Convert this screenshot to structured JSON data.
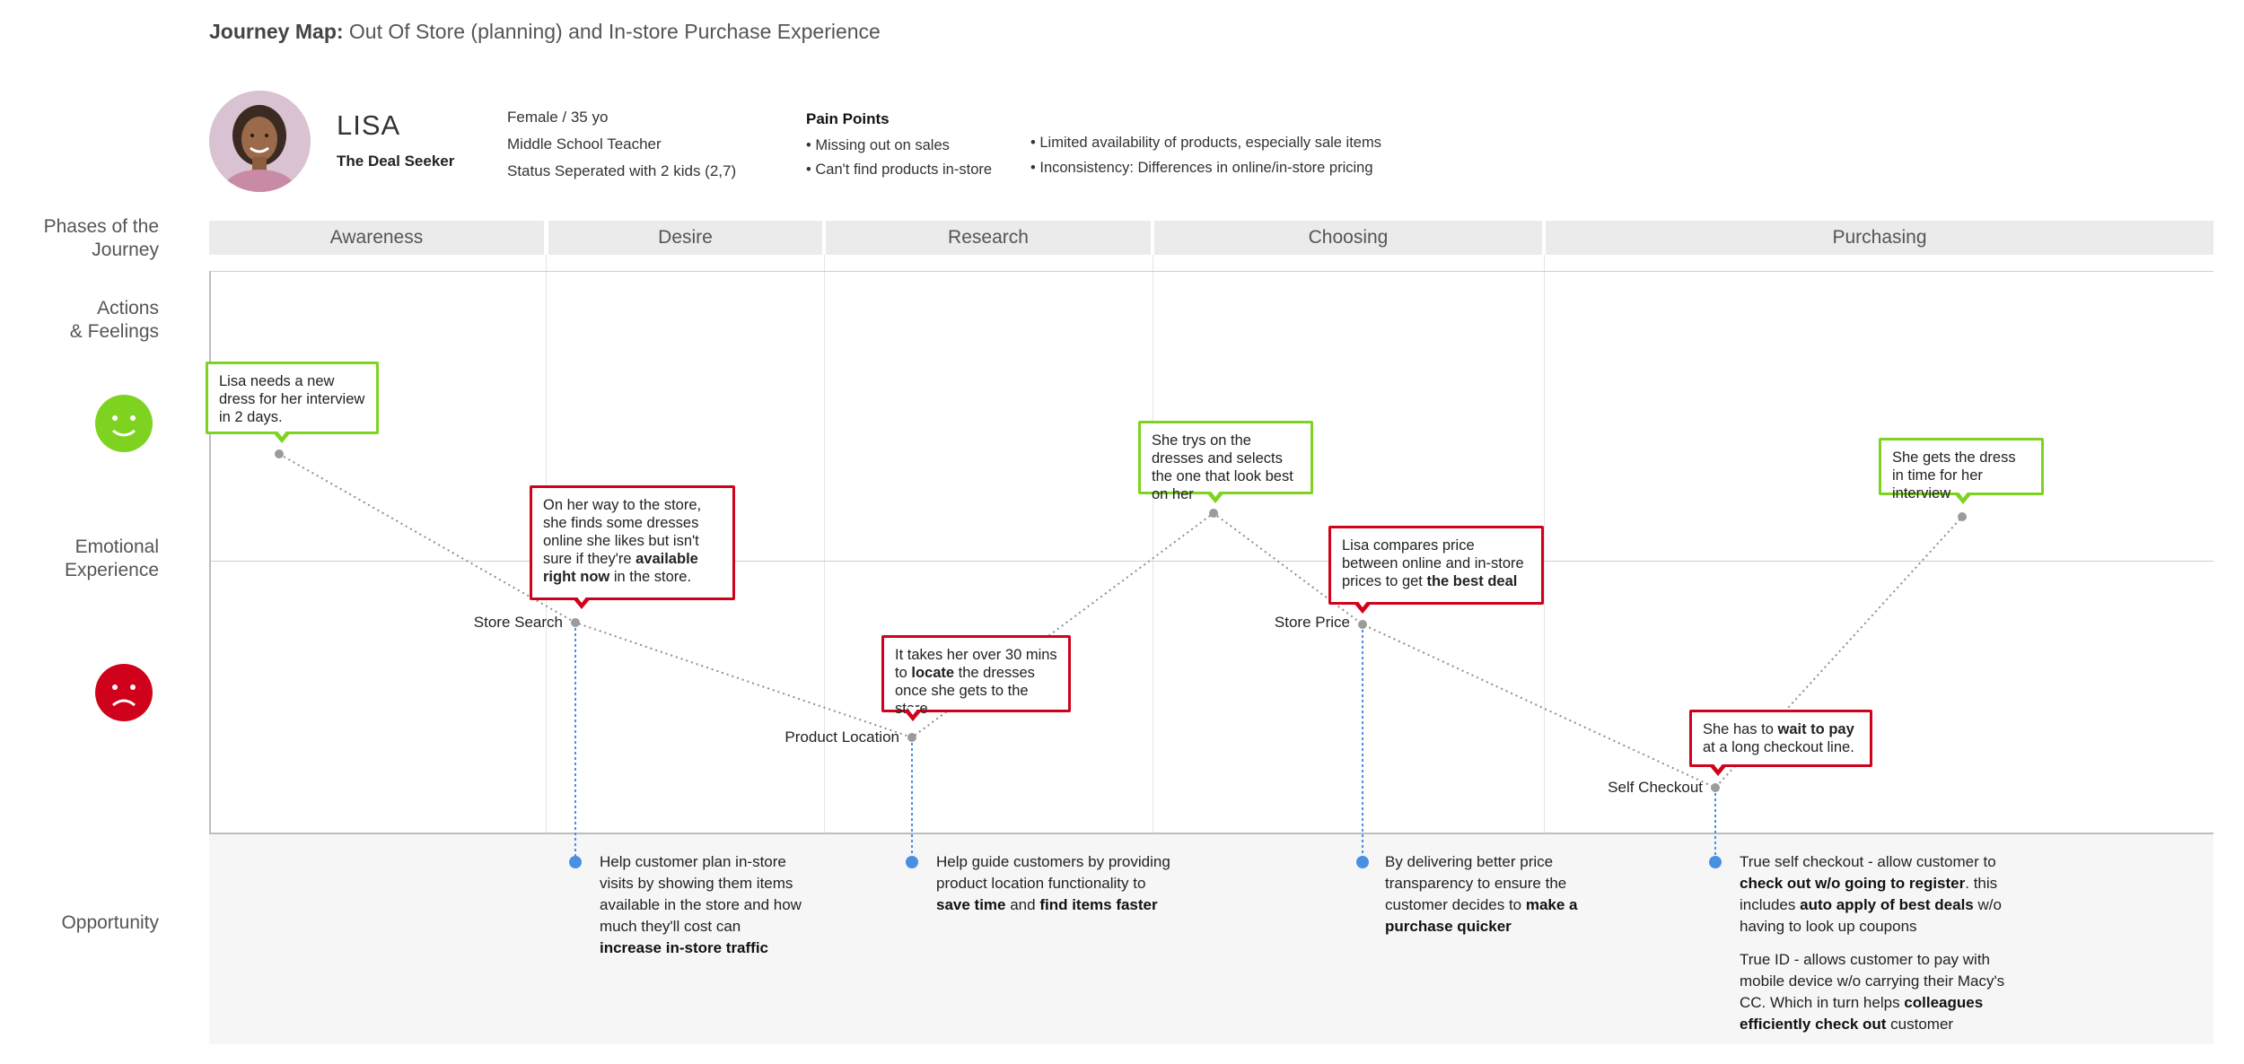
{
  "header": {
    "title_bold": "Journey Map:",
    "title_rest": " Out Of Store (planning) and In-store Purchase Experience"
  },
  "persona": {
    "name": "LISA",
    "subtitle": "The Deal Seeker",
    "details": [
      "Female / 35 yo",
      "Middle School Teacher",
      "Status Seperated with 2 kids (2,7)"
    ],
    "pain_points_title": "Pain Points",
    "pain_points_col1": [
      "Missing out on sales",
      "Can't find products in-store"
    ],
    "pain_points_col2": [
      "Limited availability of products, especially sale items",
      "Inconsistency:  Differences in online/in-store pricing"
    ]
  },
  "row_labels": {
    "phases": [
      "Phases of the",
      "Journey"
    ],
    "actions": [
      "Actions",
      "& Feelings"
    ],
    "emotional": [
      "Emotional",
      "Experience"
    ],
    "opportunity": "Opportunity"
  },
  "phases": [
    "Awareness",
    "Desire",
    "Research",
    "Choosing",
    "Purchasing"
  ],
  "colors": {
    "positive": "#7ed321",
    "negative": "#d0021b",
    "opportunity_dot": "#4a90e2",
    "journey_point": "#9b9b9b"
  },
  "icons": {
    "happy": "smiling-face-icon",
    "sad": "frowning-face-icon"
  },
  "journey": {
    "points": [
      {
        "id": "p1",
        "emotion": "positive",
        "label": ""
      },
      {
        "id": "p2",
        "emotion": "negative",
        "label": "Store Search"
      },
      {
        "id": "p3",
        "emotion": "negative",
        "label": "Product Location"
      },
      {
        "id": "p4",
        "emotion": "positive",
        "label": ""
      },
      {
        "id": "p5",
        "emotion": "negative",
        "label": "Store Price"
      },
      {
        "id": "p6",
        "emotion": "negative",
        "label": "Self Checkout"
      },
      {
        "id": "p7",
        "emotion": "positive",
        "label": ""
      }
    ],
    "callouts": {
      "c1": "Lisa needs a new dress for her interview in 2 days.",
      "c2_a": "On her way to the store, she finds some dresses online she likes but isn't sure if they're ",
      "c2_b": "available right now",
      "c2_c": " in the store.",
      "c3_a": "It takes her over 30 mins to ",
      "c3_b": "locate",
      "c3_c": " the dresses once she gets to the store",
      "c4": "She trys on the dresses and selects the one that look best on her",
      "c5_a": "Lisa compares price between online and in-store prices to get ",
      "c5_b": "the best deal",
      "c6_a": "She has to ",
      "c6_b": "wait to pay",
      "c6_c": " at a long checkout line.",
      "c7": "She gets the dress in time for her interview"
    }
  },
  "opportunities": {
    "o1_a": "Help customer plan in-store visits by showing them items available in the store and how much they'll cost can ",
    "o1_b": "increase in-store traffic",
    "o2_a": "Help guide customers by providing product location functionality to ",
    "o2_b": "save time",
    "o2_c": " and ",
    "o2_d": "find items faster",
    "o3_a": "By delivering better price transparency to ensure the customer decides to ",
    "o3_b": "make a purchase quicker",
    "o4_a": "True self checkout - allow customer to ",
    "o4_b": "check out w/o going to register",
    "o4_c": ". this includes ",
    "o4_d": "auto apply of best deals",
    "o4_e": " w/o having to look up coupons",
    "o5_a": "True ID - allows customer to pay with mobile device w/o carrying their Macy's CC. Which in turn helps ",
    "o5_b": "colleagues efficiently check out",
    "o5_c": " customer"
  }
}
